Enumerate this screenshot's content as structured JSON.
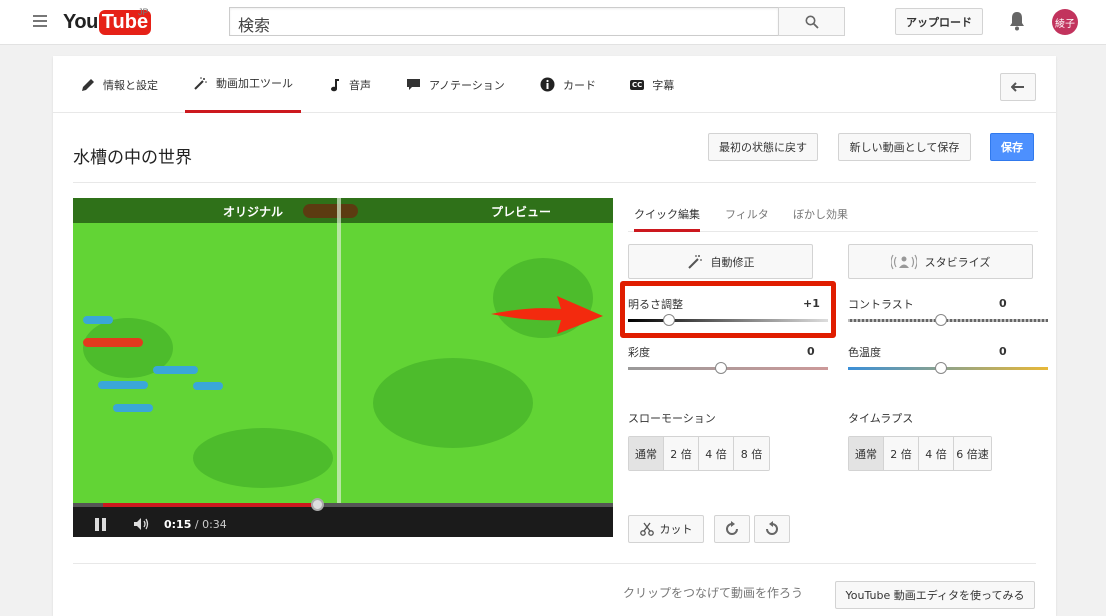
{
  "header": {
    "logo_you": "You",
    "logo_tube": "Tube",
    "logo_region": "JP",
    "search_value": "検索",
    "upload_label": "アップロード",
    "avatar_text": "綾子"
  },
  "tabs": [
    {
      "label": "情報と設定",
      "icon": "pencil-icon"
    },
    {
      "label": "動画加工ツール",
      "icon": "magic-wand-icon"
    },
    {
      "label": "音声",
      "icon": "music-note-icon"
    },
    {
      "label": "アノテーション",
      "icon": "speech-bubble-icon"
    },
    {
      "label": "カード",
      "icon": "info-circle-icon"
    },
    {
      "label": "字幕",
      "icon": "cc-icon"
    }
  ],
  "video_title": "水槽の中の世界",
  "actions": {
    "revert": "最初の状態に戻す",
    "save_as_new": "新しい動画として保存",
    "save": "保存"
  },
  "player": {
    "original_label": "オリジナル",
    "preview_label": "プレビュー",
    "current_time": "0:15",
    "total_time": "/ 0:34",
    "progress": 0.44
  },
  "edit_tabs": [
    "クイック編集",
    "フィルタ",
    "ぼかし効果"
  ],
  "quick_edit": {
    "autofix_label": "自動修正",
    "stabilize_label": "スタビライズ",
    "brightness": {
      "label": "明るさ調整",
      "value": "+1"
    },
    "contrast": {
      "label": "コントラスト",
      "value": "0"
    },
    "saturation": {
      "label": "彩度",
      "value": "0"
    },
    "temperature": {
      "label": "色温度",
      "value": "0"
    }
  },
  "slow_motion": {
    "label": "スローモーション",
    "options": [
      "通常",
      "2 倍",
      "4 倍",
      "8 倍"
    ],
    "selected": "通常"
  },
  "timelapse": {
    "label": "タイムラプス",
    "options": [
      "通常",
      "2 倍",
      "4 倍",
      "6 倍速"
    ],
    "selected": "通常"
  },
  "cut_label": "カット",
  "footer": {
    "clip_text": "クリップをつなげて動画を作ろう",
    "editor_button": "YouTube 動画エディタを使ってみる"
  },
  "colors": {
    "accent_red": "#cc181e",
    "primary_blue": "#4d90fe",
    "highlight_red": "#e01d00"
  }
}
